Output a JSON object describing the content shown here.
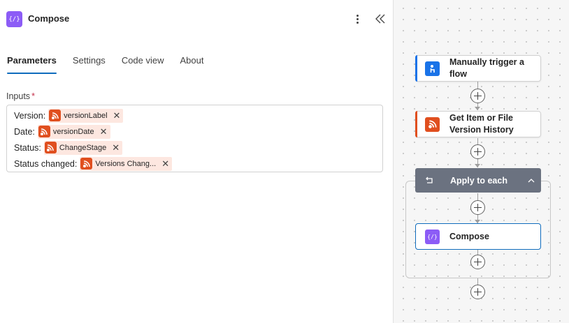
{
  "panel": {
    "title": "Compose",
    "icon": "compose-icon",
    "icon_glyph": "{/}",
    "more_icon": "more-vertical-icon",
    "collapse_icon": "double-chevron-left-icon"
  },
  "tabs": [
    {
      "label": "Parameters",
      "active": true
    },
    {
      "label": "Settings",
      "active": false
    },
    {
      "label": "Code view",
      "active": false
    },
    {
      "label": "About",
      "active": false
    }
  ],
  "inputs": {
    "label": "Inputs",
    "required_mark": "*",
    "rows": [
      {
        "label": "Version:",
        "token": "versionLabel"
      },
      {
        "label": "Date:",
        "token": "versionDate"
      },
      {
        "label": "Status:",
        "token": "ChangeStage"
      },
      {
        "label": "Status changed:",
        "token": "Versions Chang..."
      }
    ],
    "token_icon": "sharepoint-icon",
    "remove_icon": "close-icon",
    "remove_glyph": "✕"
  },
  "flow": {
    "trigger": {
      "title": "Manually trigger a flow",
      "icon": "manual-trigger-icon"
    },
    "action1": {
      "title": "Get Item or File Version History",
      "icon": "sharepoint-icon"
    },
    "loop": {
      "title": "Apply to each",
      "icon": "loop-icon",
      "chevron": "chevron-up-icon"
    },
    "inner_action": {
      "title": "Compose",
      "icon": "compose-icon",
      "icon_glyph": "{/}"
    },
    "add_step_icon": "add-icon"
  },
  "colors": {
    "accent_blue": "#0f6cbd",
    "compose_purple": "#8c5cf6",
    "sharepoint_orange": "#e04f1f",
    "trigger_blue": "#1a73e8",
    "loop_gray": "#6b7280",
    "token_bg": "#fde7e0"
  }
}
